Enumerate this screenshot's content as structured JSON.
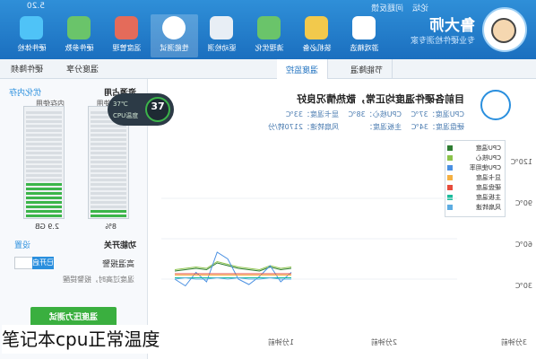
{
  "window": {
    "version": "5.20",
    "controls": [
      "论坛",
      "问题反馈"
    ]
  },
  "brand": {
    "name": "鲁大师",
    "subtitle": "专业硬件检测专家"
  },
  "toolbar": {
    "items": [
      {
        "label": "游戏精选",
        "icon": "gamepad-icon",
        "color": "#ffffff"
      },
      {
        "label": "装机必备",
        "icon": "cube-icon",
        "color": "#f2c94c"
      },
      {
        "label": "清理优化",
        "icon": "broom-icon",
        "color": "#6ac46a"
      },
      {
        "label": "驱动检测",
        "icon": "gear-icon",
        "color": "#e8eef5"
      },
      {
        "label": "性能测试",
        "icon": "speed-dial-icon",
        "color": "#ffffff"
      },
      {
        "label": "温度管理",
        "icon": "thermometer-icon",
        "color": "#e46b5a"
      },
      {
        "label": "硬件参数",
        "icon": "board-icon",
        "color": "#6ac46a"
      },
      {
        "label": "硬件体检",
        "icon": "monitor-icon",
        "color": "#4fc3f7"
      }
    ],
    "active_index": 4
  },
  "subbar": {
    "left_items": [
      "硬件降频",
      "温度分享"
    ],
    "tabs": [
      "温度监控",
      "节能降温"
    ],
    "active_tab": 0
  },
  "left_panel": {
    "resource_title": "资源占用",
    "optimize_link": "优化内存",
    "cpu_label": "CPU使用",
    "mem_label": "内存使用",
    "cpu_value": "8%",
    "mem_value": "2.9 GB",
    "cpu_level": 0.08,
    "mem_level": 0.33,
    "switch_title": "功能开关",
    "settings_link": "设置",
    "alarm_label": "高温报警",
    "alarm_state": "已开启",
    "alarm_hint": "温度过高时，报警提醒",
    "test_button": "温度压力测试"
  },
  "status": {
    "headline": "目前各硬件温度均正常，散热情况良好",
    "info_line1": [
      "CPU温度：37℃",
      "CPU核心：38℃",
      "显卡温度：33℃"
    ],
    "info_line2": [
      "硬盘温度：34℃",
      "主板温度：",
      "风扇转速：2170转/分"
    ]
  },
  "temp_badge": {
    "value": "37",
    "unit": "℃",
    "line1": "37℃",
    "line2": "CPU温度"
  },
  "chart_data": {
    "type": "line",
    "yticks": [
      "120℃",
      "90℃",
      "60℃",
      "30℃"
    ],
    "xticks": [
      "3分钟前",
      "2分钟前",
      "1分钟前",
      "现在"
    ],
    "ylim": [
      0,
      120
    ],
    "series": [
      {
        "name": "CPU温度",
        "color": "#2e7d32",
        "values": [
          36,
          37,
          38,
          37,
          42,
          40,
          38,
          37,
          36,
          39,
          37,
          38
        ]
      },
      {
        "name": "CPU核心",
        "color": "#8bc34a",
        "values": [
          37,
          38,
          39,
          38,
          43,
          41,
          39,
          38,
          37,
          40,
          38,
          39
        ]
      },
      {
        "name": "CPU使用率",
        "color": "#4a90e2",
        "values": [
          30,
          25,
          35,
          28,
          50,
          45,
          30,
          26,
          32,
          40,
          28,
          35
        ]
      },
      {
        "name": "显卡温度",
        "color": "#f5b041",
        "values": [
          33,
          33,
          33,
          33,
          33,
          33,
          33,
          33,
          33,
          33,
          33,
          33
        ]
      },
      {
        "name": "硬盘温度",
        "color": "#e74c3c",
        "values": [
          34,
          34,
          34,
          34,
          34,
          34,
          34,
          34,
          34,
          34,
          34,
          34
        ]
      },
      {
        "name": "主板温度",
        "color": "#1abc9c",
        "values": [
          31,
          31,
          31,
          31,
          31,
          31,
          31,
          31,
          31,
          31,
          31,
          31
        ]
      },
      {
        "name": "风扇转速",
        "color": "#5dade2",
        "values": [
          30,
          31,
          30,
          30,
          31,
          30,
          31,
          30,
          30,
          31,
          30,
          30
        ]
      }
    ]
  },
  "caption": "笔记本cpu正常温度"
}
